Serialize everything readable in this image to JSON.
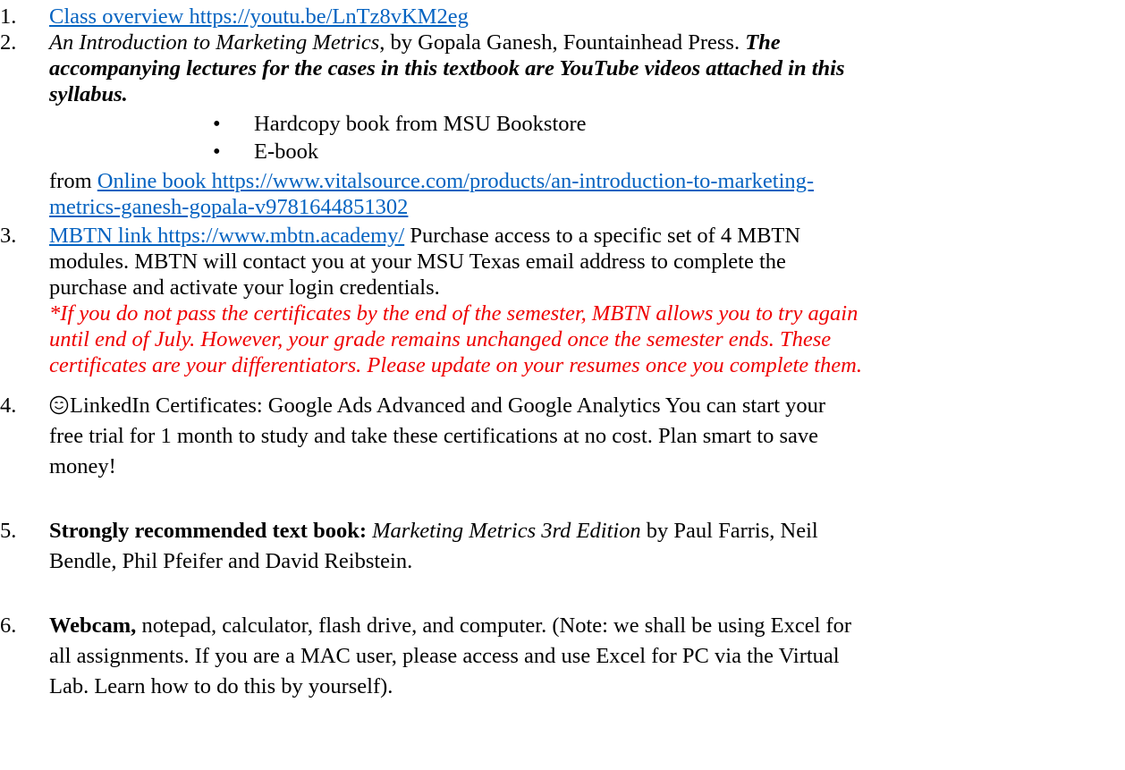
{
  "items": [
    {
      "number": "1.",
      "link_text": "Class overview https://youtu.be/LnTz8vKM2eg"
    },
    {
      "number": "2.",
      "title": "An Introduction to Marketing Metrics",
      "text_after_title": ", by Gopala Ganesh, Fountainhead Press.  ",
      "emphasis_line1": "The",
      "emphasis_line2": "accompanying lectures for the cases in this textbook are YouTube videos attached in this",
      "emphasis_line3": "syllabus.",
      "bullets": [
        "Hardcopy book from MSU Bookstore",
        "E-book"
      ],
      "from_label": "from ",
      "link_line1": "Online book https://www.vitalsource.com/products/an-introduction-to-marketing-",
      "link_line2": "metrics-ganesh-gopala-v9781644851302"
    },
    {
      "number": "3.",
      "link_text": "MBTN link https://www.mbtn.academy/",
      "line1_rest": " Purchase access to a specific set of 4 MBTN",
      "line2": "modules. MBTN will contact you at your MSU Texas email address to complete the",
      "line3": "purchase and activate your login credentials.",
      "note_line1": "*If you do not pass the certificates by the end of the semester, MBTN allows you to try again",
      "note_line2": "until end of July. However, your grade remains unchanged once the semester ends. These",
      "note_line3": "certificates are your differentiators. Please update on your resumes once you complete them."
    },
    {
      "number": "4.",
      "icon": "smiley-icon",
      "line1": "LinkedIn Certificates: Google Ads Advanced and Google Analytics  You can start your",
      "line2": "free trial for 1 month to study and take these certifications at no cost. Plan smart to save",
      "line3": "money!"
    },
    {
      "number": "5.",
      "bold_label": "Strongly recommended text book:",
      "italic_title": "Marketing Metrics 3rd Edition",
      "line1_rest": " by Paul Farris, Neil",
      "line2": "Bendle, Phil Pfeifer and David Reibstein."
    },
    {
      "number": "6.",
      "bold_label": "Webcam,",
      "line1_rest": " notepad, calculator, flash drive, and computer. (Note: we shall be using Excel for",
      "line2": "all assignments. If you are a MAC user, please access and use Excel for PC via the Virtual",
      "line3": "Lab. Learn how to do this by yourself)."
    }
  ],
  "colors": {
    "link": "#0563c1",
    "note": "#ee0000",
    "text": "#000000"
  }
}
